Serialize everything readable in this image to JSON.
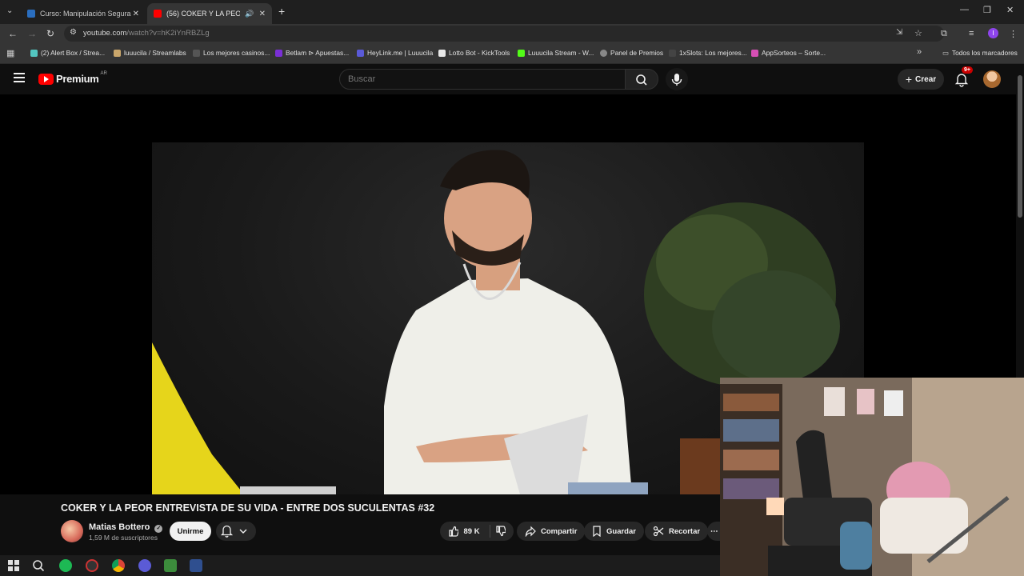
{
  "browser": {
    "tabs": [
      {
        "title": "Curso: Manipulación Segura de",
        "active": false
      },
      {
        "title": "(56) COKER Y LA PEOR ENT",
        "active": true
      }
    ],
    "url_main": "youtube.com",
    "url_path": "/watch?v=hK2iYnRBZLg",
    "bookmarks": [
      "(2) Alert Box / Strea...",
      "luuucila / Streamlabs",
      "Los mejores casinos...",
      "Betlam ⊳ Apuestas...",
      "HeyLink.me | Luuucila",
      "Lotto Bot - KickTools",
      "Luuucila Stream - W...",
      "Panel de Premios",
      "1xSlots: Los mejores...",
      "AppSorteos – Sorte..."
    ],
    "all_bookmarks": "Todos los marcadores"
  },
  "youtube": {
    "logo_text": "Premium",
    "country": "AR",
    "search_placeholder": "Buscar",
    "create_label": "Crear",
    "notif_badge": "9+"
  },
  "video": {
    "title": "COKER Y LA PEOR ENTREVISTA DE SU VIDA - ENTRE DOS SUCULENTAS #32",
    "channel": "Matias Bottero",
    "subscribers": "1,59 M de suscriptores",
    "join_label": "Unirme",
    "likes": "89 K",
    "share_label": "Compartir",
    "save_label": "Guardar",
    "clip_label": "Recortar"
  },
  "colors": {
    "yt_red": "#ff0000",
    "accent_purple": "#8e44ec"
  }
}
